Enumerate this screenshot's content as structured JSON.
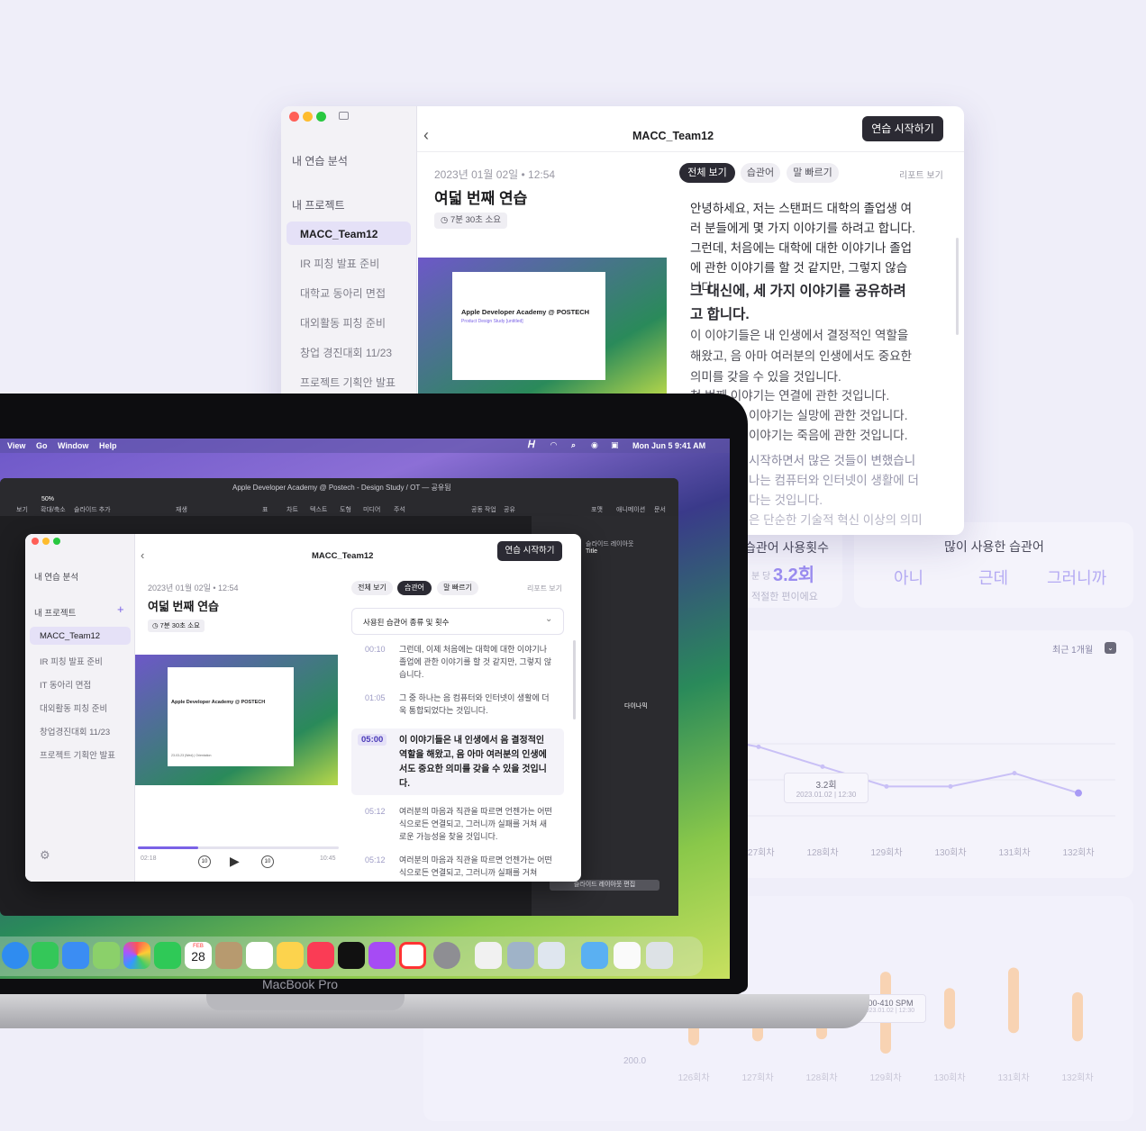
{
  "window": {
    "title": "MACC_Team12",
    "start_button": "연습 시작하기",
    "sidebar": {
      "analysis": "내 연습 분석",
      "projects_header": "내 프로젝트",
      "items": [
        "MACC_Team12",
        "IR 피칭 발표 준비",
        "대학교 동아리 면접",
        "대외활동 피칭 준비",
        "창업 경진대회 11/23",
        "프로젝트 기획안 발표"
      ]
    },
    "session": {
      "date": "2023년 01월 02일 • 12:54",
      "title": "여덟 번째 연습",
      "duration": "7분 30초 소요"
    },
    "tabs": [
      "전체 보기",
      "습관어",
      "말 빠르기"
    ],
    "report_link": "리포트 보기",
    "transcript": [
      "안녕하세요, 저는 스탠퍼드 대학의 졸업생 여러 분들에게 몇 가지 이야기를 하려고 합니다.",
      "그런데, 처음에는 대학에 대한 이야기나 졸업에 관한 이야기를 할 것 같지만, 그렇지 않습니다.",
      "그 대신에, 세 가지 이야기를 공유하려고 합니다.",
      "이 이야기들은 내 인생에서 결정적인 역할을 해왔고, 음 아마 여러분의 인생에서도 중요한 의미를 갖을 수 있을 것입니다.",
      "첫 번째 이야기는 연결에 관한 것입니다.",
      "이야기는 실망에 관한 것입니다.",
      "이야기는 죽음에 관한 것입니다.",
      "시작하면서 많은 것들이 변했습니",
      "나는 컴퓨터와 인터넷이 생활에 더",
      "다는 것입니다.",
      "은 단순한 기술적 혁신 이상의 의미"
    ]
  },
  "background": {
    "filler_usage": {
      "title": "습관어 사용횟수",
      "value": "3.2회",
      "unit": "분 당",
      "note": "적절한 편이에요"
    },
    "most_used": {
      "title": "많이 사용한 습관어",
      "words": [
        "아니",
        "근데",
        "그러니까"
      ]
    },
    "period": "최근 1개월",
    "line_tooltip": {
      "value": "3.2회",
      "date": "2023.01.02 | 12:30"
    },
    "speed_tooltip": {
      "value": "200-410 SPM",
      "date": "2023.01.02 | 12:30"
    },
    "speed_axis": "200.0"
  },
  "chart_data": [
    {
      "type": "line",
      "title": "",
      "categories": [
        "127회차",
        "128회차",
        "129회차",
        "130회차",
        "131회차",
        "132회차"
      ],
      "values": [
        3.6,
        3.3,
        3.0,
        3.0,
        3.2,
        2.9
      ],
      "annotation": "3.2회 2023.01.02 | 12:30"
    },
    {
      "type": "bar",
      "title": "",
      "categories": [
        "126회차",
        "127회차",
        "128회차",
        "129회차",
        "130회차",
        "131회차",
        "132회차"
      ],
      "ylabel": "",
      "series": [
        {
          "values_low": [
            200,
            210,
            215,
            180,
            240,
            230,
            210
          ],
          "values_high": [
            270,
            300,
            260,
            380,
            340,
            390,
            330
          ]
        }
      ],
      "annotation": "200-410 SPM"
    }
  ],
  "laptop": {
    "brand": "MacBook Pro",
    "menubar": {
      "items": [
        "View",
        "Go",
        "Window",
        "Help"
      ],
      "clock": "Mon Jun 5  9:41 AM"
    },
    "keynote_title": "Apple Developer Academy @ Postech - Design Study / OT — 공유됨",
    "toolbar": [
      "보기",
      "확대/축소",
      "슬라이드 추가",
      "재생",
      "표",
      "차트",
      "텍스트",
      "도형",
      "미디어",
      "주석",
      "공동 작업",
      "공유",
      "포맷",
      "애니메이션",
      "문서"
    ],
    "zoom": "50%",
    "slide_layout_label": "슬라이드 레이아웃",
    "slide_layout_value": "Title",
    "dynamic": "다이나믹",
    "edit_layout_btn": "슬라이드 레이아웃 편집",
    "slide_title": "Apple Developer Academy @ POSTECH",
    "slide_sub": "Product Design Study [untitled]",
    "slide_date": "23-03-23 (Wed) | Orientation",
    "dock_date": "28",
    "dock_month": "FEB"
  },
  "mini": {
    "title": "MACC_Team12",
    "start_button": "연습 시작하기",
    "analysis": "내 연습 분석",
    "projects_header": "내 프로젝트",
    "items": [
      "MACC_Team12",
      "IR 피칭 발표 준비",
      "IT 동아리 면접",
      "대외활동 피칭 준비",
      "창업경진대회 11/23",
      "프로젝트 기획안 발표"
    ],
    "date": "2023년 01월 02일 • 12:54",
    "session_title": "여덟 번째 연습",
    "duration": "7분 30초 소요",
    "tabs": [
      "전체 보기",
      "습관어",
      "말 빠르기"
    ],
    "report_link": "리포트 보기",
    "dropdown": "사용된 습관어 종류 및 횟수",
    "entries": [
      {
        "time": "00:10",
        "text": "그런데, 이제 처음에는 대학에 대한 이야기나 졸업에 관한 이야기를 할 것 같지만, 그렇지 않습니다."
      },
      {
        "time": "01:05",
        "text": "그 중 하나는 음 컴퓨터와 인터넷이 생활에 더욱 통합되었다는 것입니다."
      },
      {
        "time": "05:00",
        "text": "이 이야기들은 내 인생에서 음 결정적인 역할을 해왔고, 음 아마 여러분의 인생에서도 중요한 의미를 갖을 수 있을 것입니다."
      },
      {
        "time": "05:12",
        "text": "여러분의 마음과 직관을 따르면 언젠가는 어떤 식으로든 연결되고, 그러니까 실패를 거쳐 새로운 가능성을 찾을 것입니다."
      },
      {
        "time": "05:12",
        "text": "여러분의 마음과 직관을 따르면 언젠가는 어떤 식으로든 연결되고, 그러니까 실패를 거쳐"
      }
    ],
    "time_start": "02:18",
    "time_end": "10:45",
    "skip_seconds": "10",
    "progress": 0.3
  },
  "colors": {
    "accent": "#7a62e6",
    "dark": "#2b2a33",
    "selected": "#e5e1f7",
    "highlight": "#f6b98a"
  }
}
